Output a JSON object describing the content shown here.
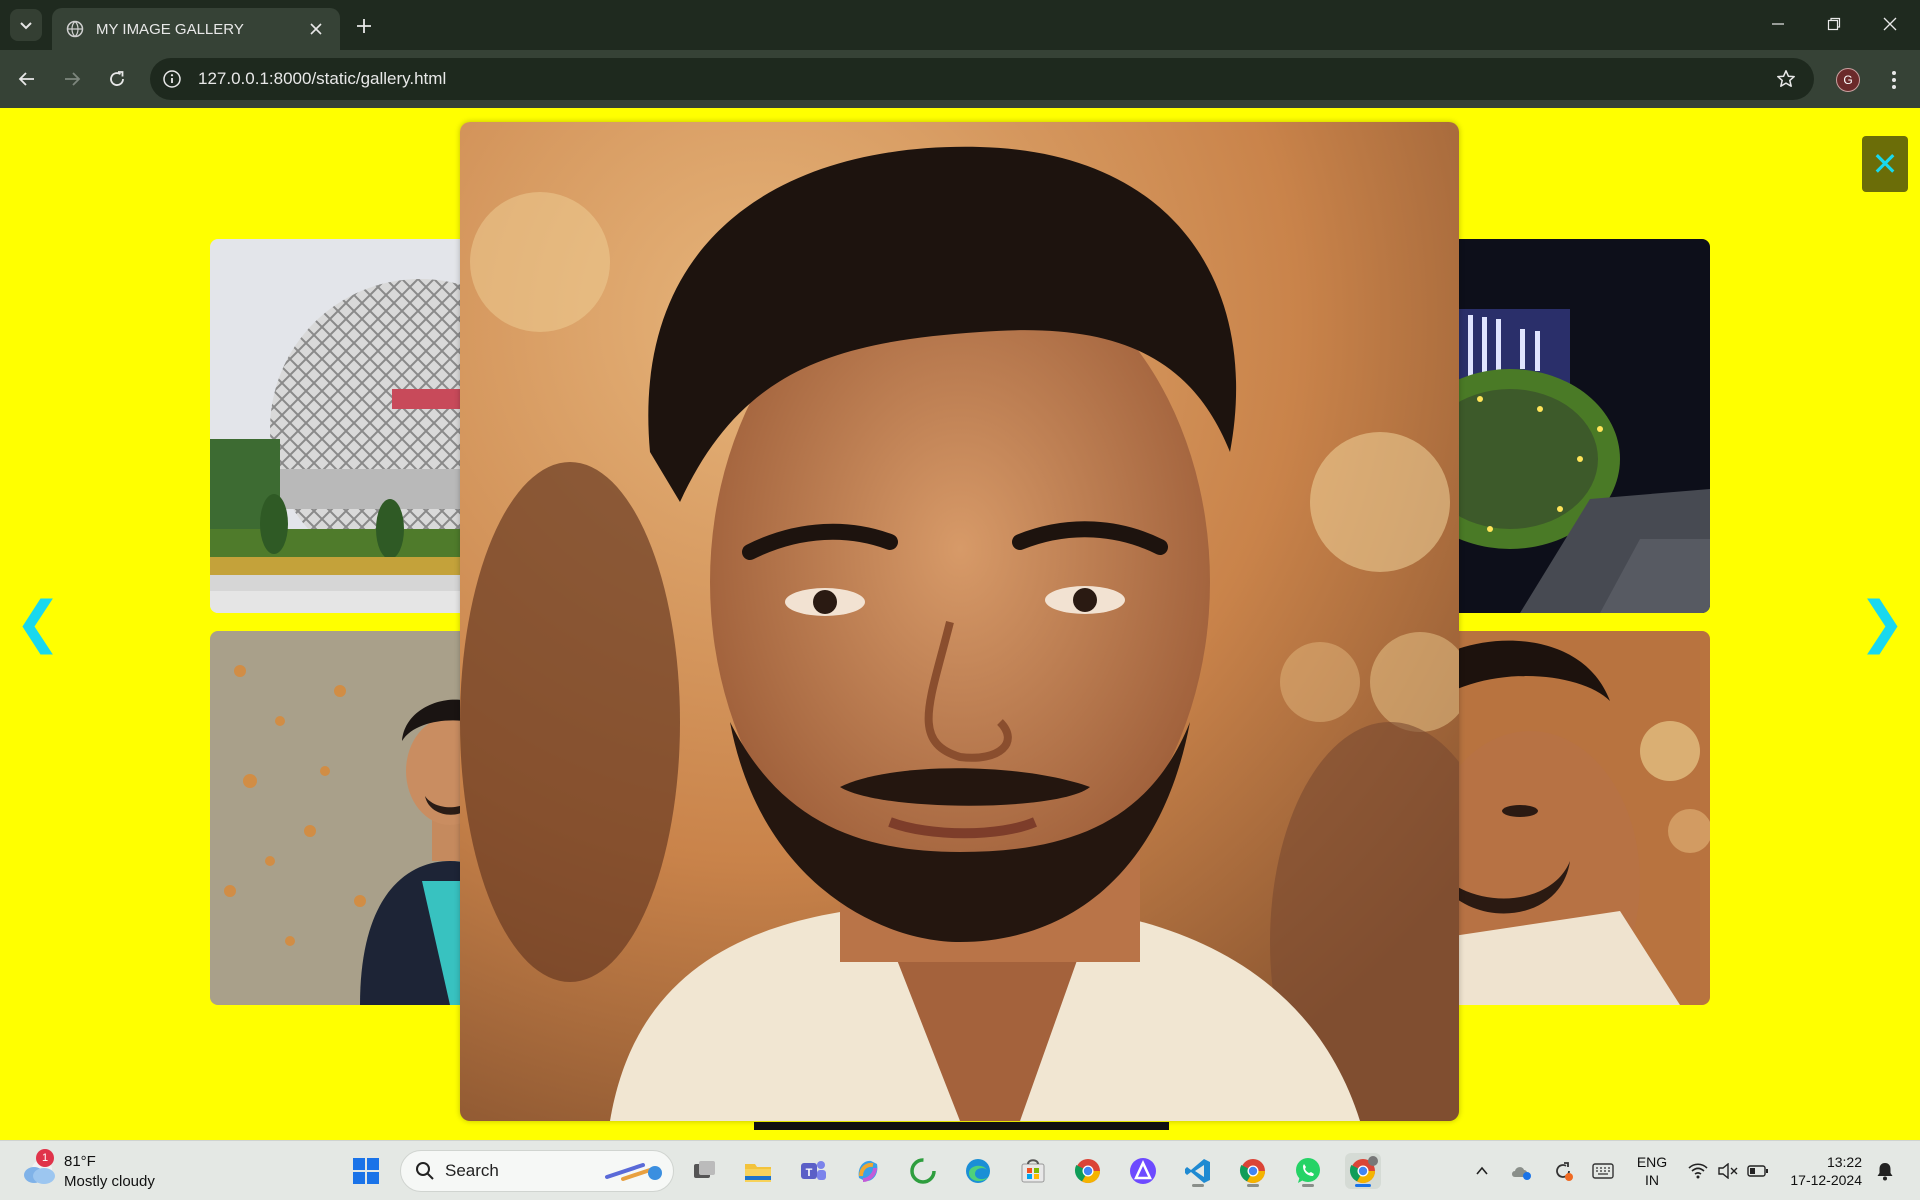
{
  "browser": {
    "tab_title": "MY IMAGE GALLERY",
    "url": "127.0.0.1:8000/static/gallery.html",
    "profile_initial": "G"
  },
  "gallery": {
    "close_label": "✕",
    "prev_label": "❮",
    "next_label": "❯",
    "background_color": "#ffff00",
    "accent_color": "#19d8ee",
    "thumbnails": [
      {
        "subject": "circular lattice building"
      },
      {
        "subject": "portrait man in blazer"
      },
      {
        "subject": "night floral clock"
      },
      {
        "subject": "portrait man close-up"
      }
    ],
    "lightbox_subject": "portrait man close-up"
  },
  "taskbar": {
    "weather_badge": "1",
    "temperature": "81°F",
    "condition": "Mostly cloudy",
    "search_label": "Search",
    "language_line1": "ENG",
    "language_line2": "IN",
    "time": "13:22",
    "date": "17-12-2024",
    "apps": [
      "start-icon",
      "task-view-icon",
      "file-explorer-icon",
      "teams-icon",
      "copilot-icon",
      "refresh-app-icon",
      "edge-icon",
      "store-icon",
      "chrome-icon",
      "proton-vpn-icon",
      "vscode-icon",
      "chrome-icon",
      "whatsapp-icon",
      "chrome-profile-icon"
    ]
  }
}
